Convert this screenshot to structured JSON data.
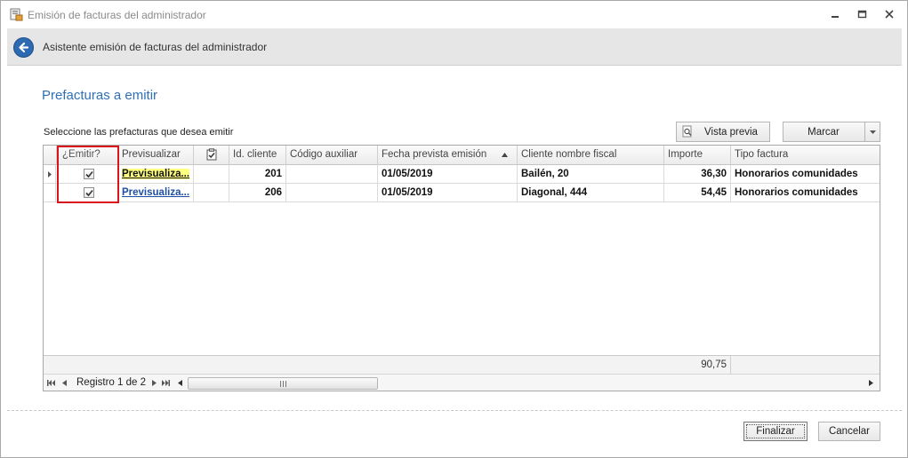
{
  "window": {
    "title": "Emisión de facturas del administrador",
    "min_label": "—",
    "max_label": "▢",
    "close_label": "✕"
  },
  "header": {
    "title": "Asistente emisión de facturas del administrador"
  },
  "section": {
    "title": "Prefacturas a emitir",
    "instruction": "Seleccione las prefacturas que desea emitir"
  },
  "toolbar": {
    "preview_label": "Vista previa",
    "mark_label": "Marcar"
  },
  "grid": {
    "columns": {
      "emitir": "¿Emitir?",
      "previsualizar": "Previsualizar",
      "id_cliente": "Id. cliente",
      "codigo_auxiliar": "Código auxiliar",
      "fecha": "Fecha prevista emisión",
      "cliente": "Cliente nombre fiscal",
      "importe": "Importe",
      "tipo": "Tipo factura"
    },
    "rows": [
      {
        "emitir": true,
        "previsualizar": "Previsualiza...",
        "id_cliente": "201",
        "codigo_auxiliar": "",
        "fecha": "01/05/2019",
        "cliente": "Bailén, 20",
        "importe": "36,30",
        "tipo": "Honorarios comunidades"
      },
      {
        "emitir": true,
        "previsualizar": "Previsualiza...",
        "id_cliente": "206",
        "codigo_auxiliar": "",
        "fecha": "01/05/2019",
        "cliente": "Diagonal, 444",
        "importe": "54,45",
        "tipo": "Honorarios comunidades"
      }
    ],
    "summary_importe": "90,75",
    "record_text": "Registro 1 de 2"
  },
  "footer": {
    "finish_label": "Finalizar",
    "cancel_label": "Cancelar"
  }
}
